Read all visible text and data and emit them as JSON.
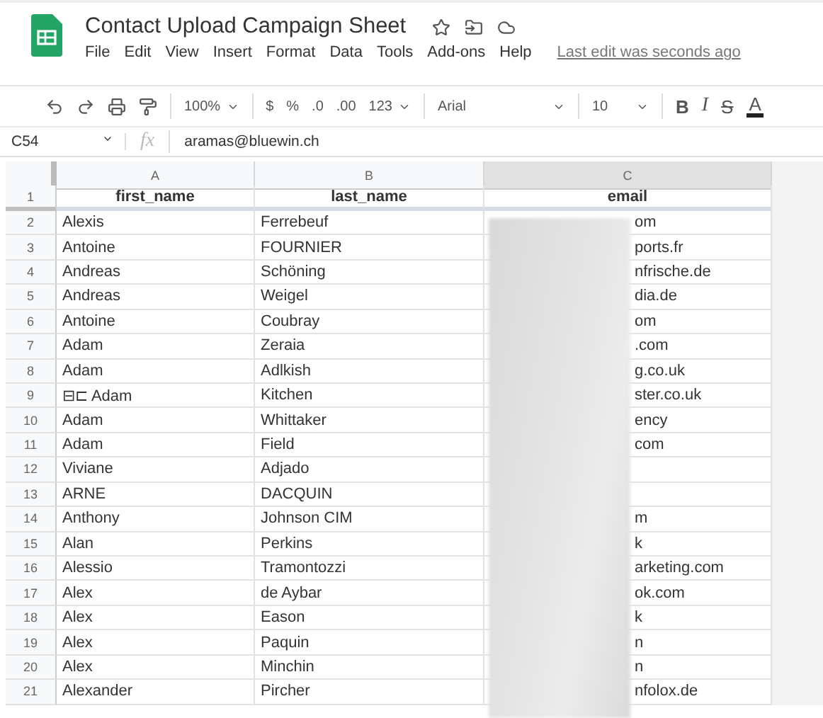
{
  "document": {
    "title": "Contact Upload Campaign Sheet",
    "last_edit": "Last edit was seconds ago"
  },
  "menu": [
    "File",
    "Edit",
    "View",
    "Insert",
    "Format",
    "Data",
    "Tools",
    "Add-ons",
    "Help"
  ],
  "toolbar": [
    {
      "kind": "dropdown",
      "label": "100%"
    },
    {
      "kind": "text",
      "label": "$"
    },
    {
      "kind": "text",
      "label": "%"
    },
    {
      "kind": "text",
      "label": ".0"
    },
    {
      "kind": "text",
      "label": ".00"
    },
    {
      "kind": "dropdown",
      "label": "123"
    },
    {
      "kind": "wide-dropdown",
      "label": "Arial"
    },
    {
      "kind": "wide-dropdown",
      "label": "10"
    },
    {
      "kind": "bold",
      "label": "B"
    },
    {
      "kind": "italic",
      "label": "I"
    },
    {
      "kind": "strike",
      "label": "S"
    },
    {
      "kind": "color",
      "label": "A"
    }
  ],
  "formula_bar": {
    "cell_ref": "C54",
    "fx": "fx",
    "value": "aramas@bluewin.ch"
  },
  "columns": [
    {
      "letter": "A",
      "selected": false
    },
    {
      "letter": "B",
      "selected": false
    },
    {
      "letter": "C",
      "selected": true
    }
  ],
  "header_row": {
    "number": "1",
    "cells": [
      "first_name",
      "last_name",
      "email"
    ]
  },
  "rows": [
    {
      "number": "2",
      "first_name": "Alexis",
      "last_name": "Ferrebeuf",
      "email": "om"
    },
    {
      "number": "3",
      "first_name": "Antoine",
      "last_name": "FOURNIER",
      "email": "ports.fr"
    },
    {
      "number": "4",
      "first_name": "Andreas",
      "last_name": "Schöning",
      "email": "nfrische.de"
    },
    {
      "number": "5",
      "first_name": "Andreas",
      "last_name": "Weigel",
      "email": "dia.de"
    },
    {
      "number": "6",
      "first_name": "Antoine",
      "last_name": "Coubray",
      "email": "om"
    },
    {
      "number": "7",
      "first_name": "Adam",
      "last_name": "Zeraia",
      "email": ".com"
    },
    {
      "number": "8",
      "first_name": "Adam",
      "last_name": "Adlkish",
      "email": "g.co.uk"
    },
    {
      "number": "9",
      "first_name": "⊟⊏ Adam",
      "last_name": "Kitchen",
      "email": "ster.co.uk"
    },
    {
      "number": "10",
      "first_name": "Adam",
      "last_name": "Whittaker",
      "email": "ency"
    },
    {
      "number": "11",
      "first_name": "Adam",
      "last_name": "Field",
      "email": "com"
    },
    {
      "number": "12",
      "first_name": "Viviane",
      "last_name": "Adjado",
      "email": ""
    },
    {
      "number": "13",
      "first_name": "ARNE",
      "last_name": "DACQUIN",
      "email": ""
    },
    {
      "number": "14",
      "first_name": "Anthony",
      "last_name": "Johnson CIM",
      "email": "m"
    },
    {
      "number": "15",
      "first_name": "Alan",
      "last_name": "Perkins",
      "email": "k"
    },
    {
      "number": "16",
      "first_name": "Alessio",
      "last_name": "Tramontozzi",
      "email": "arketing.com"
    },
    {
      "number": "17",
      "first_name": "Alex",
      "last_name": "de Aybar",
      "email": "ok.com"
    },
    {
      "number": "18",
      "first_name": "Alex",
      "last_name": "Eason",
      "email": "k"
    },
    {
      "number": "19",
      "first_name": "Alex",
      "last_name": "Paquin",
      "email": "n"
    },
    {
      "number": "20",
      "first_name": "Alex",
      "last_name": "Minchin",
      "email": "n"
    },
    {
      "number": "21",
      "first_name": "Alexander",
      "last_name": "Pircher",
      "email": "nfolox.de"
    }
  ]
}
